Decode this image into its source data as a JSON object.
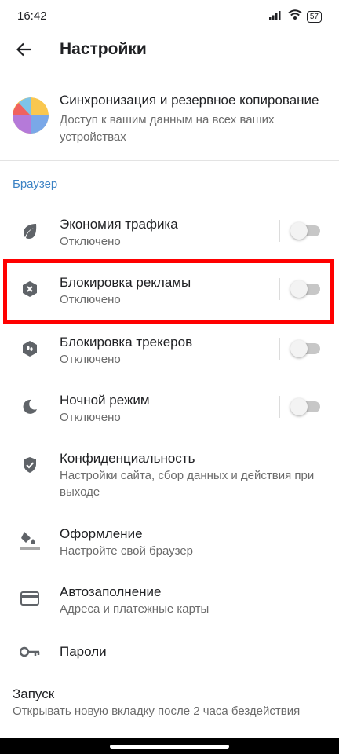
{
  "status_bar": {
    "time": "16:42",
    "battery": "57"
  },
  "header": {
    "title": "Настройки"
  },
  "sync": {
    "title": "Синхронизация и резервное копирование",
    "subtitle": "Доступ к вашим данным на всех ваших устройствах"
  },
  "section": {
    "label": "Браузер"
  },
  "rows": [
    {
      "title": "Экономия трафика",
      "subtitle": "Отключено",
      "toggle": false,
      "icon": "leaf-icon"
    },
    {
      "title": "Блокировка рекламы",
      "subtitle": "Отключено",
      "toggle": false,
      "icon": "ad-block-icon"
    },
    {
      "title": "Блокировка трекеров",
      "subtitle": "Отключено",
      "toggle": false,
      "icon": "tracker-shield-icon"
    },
    {
      "title": "Ночной режим",
      "subtitle": "Отключено",
      "toggle": false,
      "icon": "moon-icon"
    },
    {
      "title": "Конфиденциальность",
      "subtitle": "Настройки сайта, сбор данных и действия при выходе",
      "icon": "privacy-shield-icon"
    },
    {
      "title": "Оформление",
      "subtitle": "Настройте свой браузер",
      "icon": "paint-bucket-icon"
    },
    {
      "title": "Автозаполнение",
      "subtitle": "Адреса и платежные карты",
      "icon": "credit-card-icon"
    },
    {
      "title": "Пароли",
      "icon": "key-icon"
    }
  ],
  "startup": {
    "title": "Запуск",
    "subtitle": "Открывать новую вкладку после 2 часа бездействия"
  },
  "colors": {
    "accent": "#3b82c4",
    "highlight": "#ff0000",
    "icon": "#5f6368"
  }
}
